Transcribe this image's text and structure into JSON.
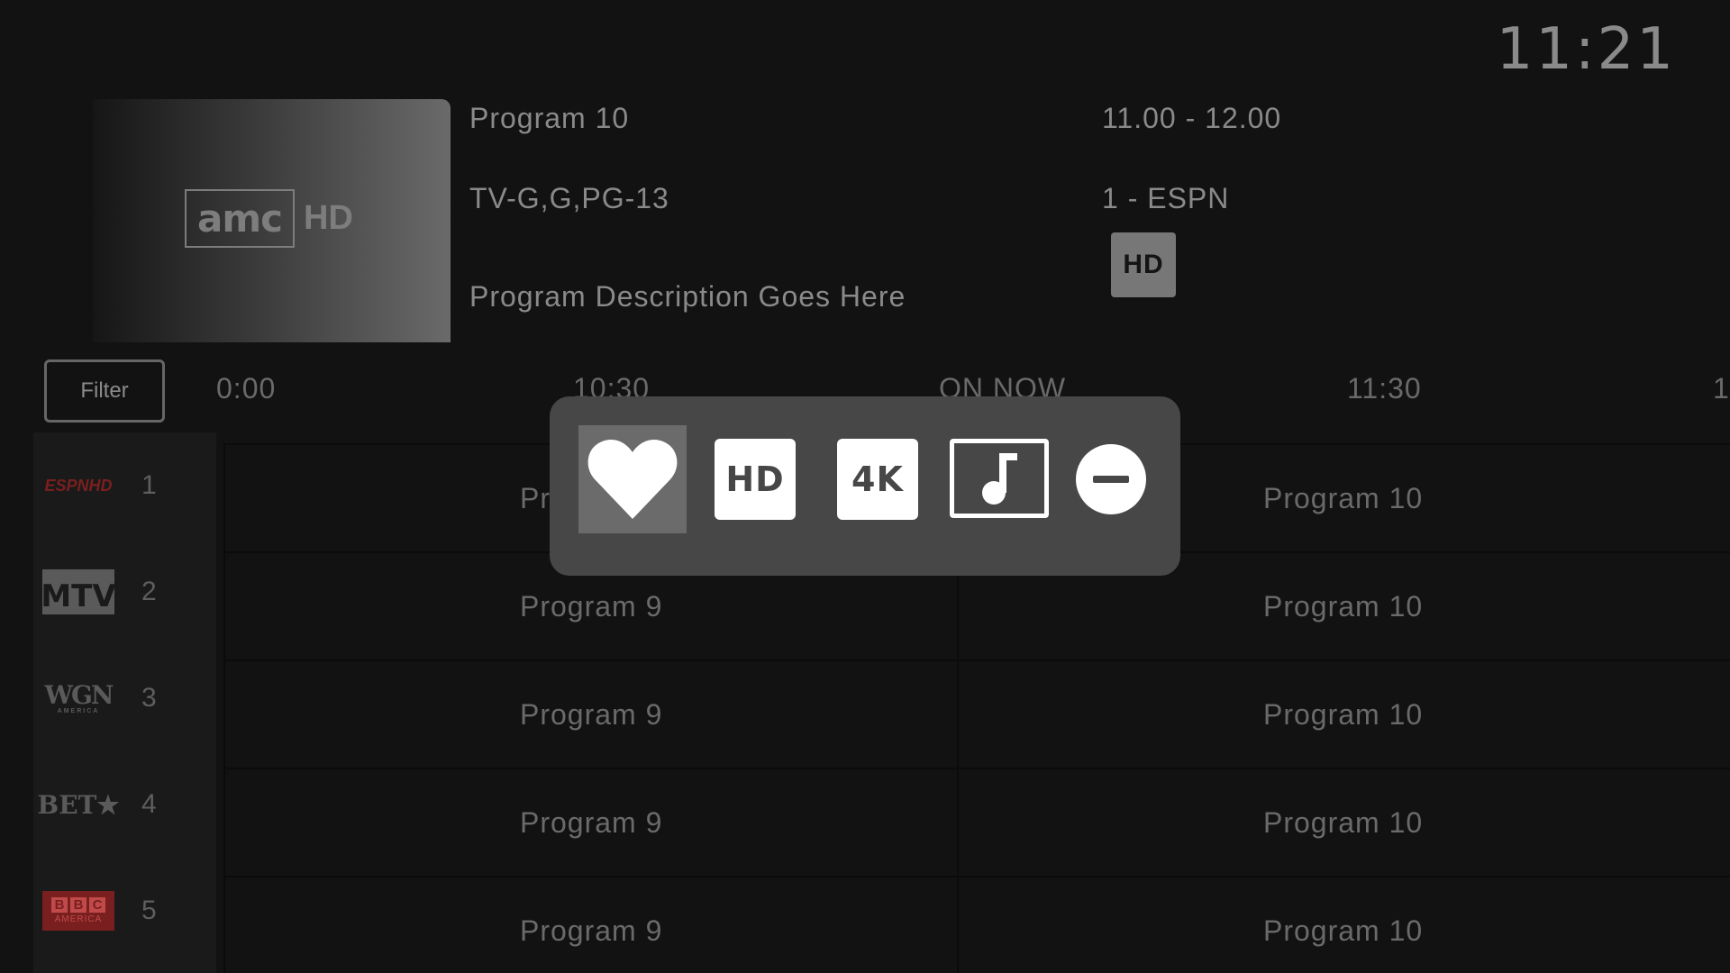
{
  "clock": "11:21",
  "thumbnail": {
    "logo_main": "amc",
    "logo_suffix": "HD"
  },
  "program": {
    "title": "Program 10",
    "rating": "TV-G,G,PG-13",
    "description": "Program Description Goes Here",
    "time": "11.00 - 12.00",
    "channel": "1 - ESPN",
    "badge": "HD"
  },
  "filter_label": "Filter",
  "timeline": [
    "0:00",
    "10:30",
    "ON NOW",
    "11:30",
    "1"
  ],
  "channels": [
    {
      "number": "1",
      "logo": "ESPNHD",
      "icon": "espn-hd-logo"
    },
    {
      "number": "2",
      "logo": "MTV",
      "icon": "mtv-logo"
    },
    {
      "number": "3",
      "logo": "WGN",
      "logo_sub": "AMERICA",
      "icon": "wgn-america-logo"
    },
    {
      "number": "4",
      "logo": "BET★",
      "icon": "bet-logo"
    },
    {
      "number": "5",
      "logo": "BBC",
      "logo_sub": "AMERICA",
      "icon": "bbc-america-logo"
    }
  ],
  "grid_rows": [
    {
      "col_a": "Pr",
      "col_b": "Program 10"
    },
    {
      "col_a": "Program 9",
      "col_b": "Program 10"
    },
    {
      "col_a": "Program 9",
      "col_b": "Program 10"
    },
    {
      "col_a": "Program 9",
      "col_b": "Program 10"
    },
    {
      "col_a": "Program 9",
      "col_b": "Program 10"
    }
  ],
  "popup_options": {
    "favorite_icon": "heart-icon",
    "hd_label": "HD",
    "uhd_label": "4K",
    "music_icon": "music-note-icon",
    "remove_icon": "minus-circle-icon"
  },
  "colors": {
    "background": "#121212",
    "popup": "#474747",
    "selected_option": "#6b6b6b",
    "bbc_red": "#7a1f1f"
  }
}
